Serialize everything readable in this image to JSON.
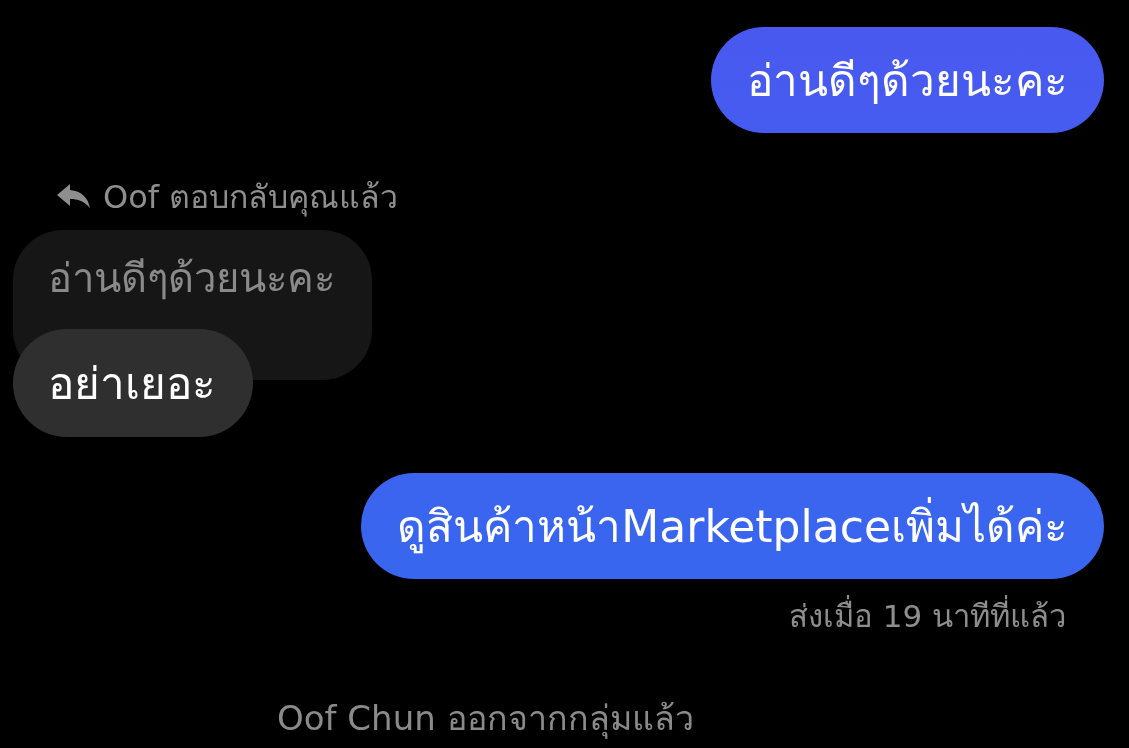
{
  "messages": [
    {
      "kind": "sent",
      "text": "อ่านดีๆด้วยนะคะ"
    },
    {
      "kind": "reply",
      "reply_label": "Oof ตอบกลับคุณแล้ว",
      "quoted_text": "อ่านดีๆด้วยนะคะ",
      "text": "อย่าเยอะ"
    },
    {
      "kind": "sent",
      "text": "ดูสินค้าหน้าMarketplaceเพิ่มได้ค่ะ",
      "status": "ส่งเมื่อ 19 นาทีที่แล้ว"
    },
    {
      "kind": "system",
      "text": "Oof Chun ออกจากกลุ่มแล้ว"
    }
  ]
}
